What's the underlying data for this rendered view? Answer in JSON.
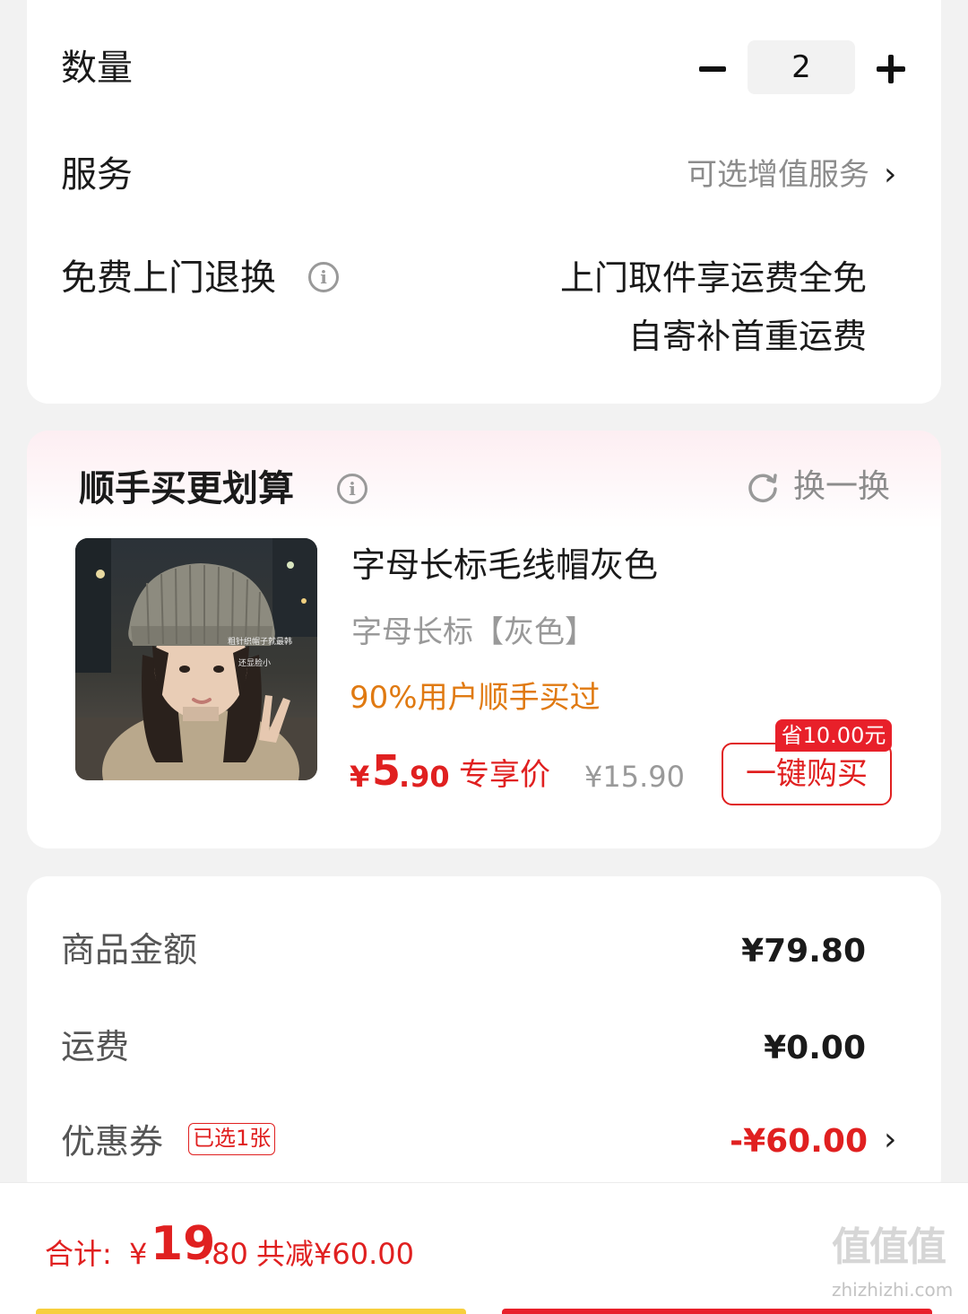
{
  "order_options": {
    "quantity_label": "数量",
    "quantity_value": "2",
    "service_label": "服务",
    "service_hint": "可选增值服务",
    "return_label": "免费上门退换",
    "return_line1": "上门取件享运费全免",
    "return_line2": "自寄补首重运费"
  },
  "addon": {
    "title": "顺手买更划算",
    "refresh_label": "换一换",
    "product": {
      "name": "字母长标毛线帽灰色",
      "spec": "字母长标【灰色】",
      "popularity": "90%用户顺手买过",
      "price_symbol": "¥",
      "price_int": "5",
      "price_dec": ".90",
      "price_tag": "专享价",
      "original_price": "¥15.90",
      "image_caption_1": "粗针织帽子就最韩",
      "image_caption_2": "还显脸小"
    },
    "buy_button": "一键购买",
    "save_badge": "省10.00元"
  },
  "summary": {
    "goods_label": "商品金额",
    "goods_value": "¥79.80",
    "shipping_label": "运费",
    "shipping_value": "¥0.00",
    "coupon_label": "优惠券",
    "coupon_tag": "已选1张",
    "coupon_value": "-¥60.00"
  },
  "bottom_bar": {
    "total_label": "合计:",
    "total_symbol": "¥",
    "total_int": "19",
    "total_dec": ".80",
    "total_saved": "共减¥60.00"
  },
  "watermark": {
    "glyphs": "值值值",
    "url": "zhizhizhi.com"
  },
  "colors": {
    "accent_red": "#e02020",
    "popular_orange": "#e07a12",
    "page_bg": "#f2f2f2"
  }
}
